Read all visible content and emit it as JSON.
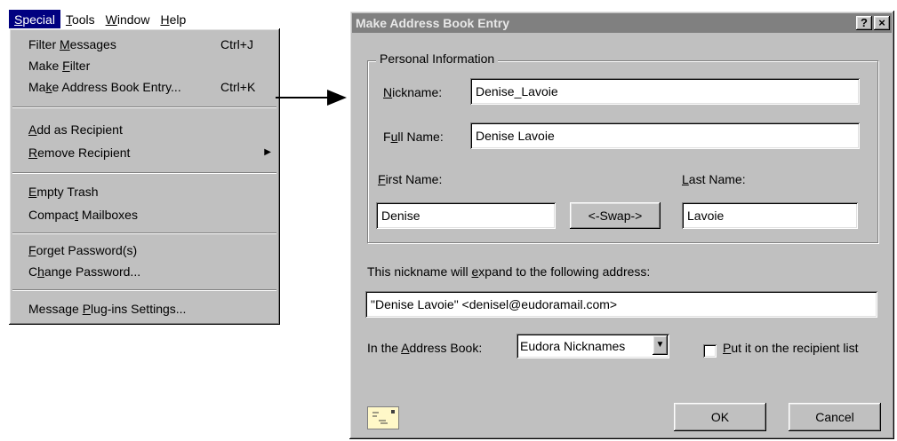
{
  "menubar": [
    {
      "label": "Special",
      "accel": "S"
    },
    {
      "label": "Tools",
      "accel": "T"
    },
    {
      "label": "Window",
      "accel": "W"
    },
    {
      "label": "Help",
      "accel": "H"
    }
  ],
  "menu": {
    "filter_messages": {
      "pre": "Filter ",
      "acc": "M",
      "post": "essages",
      "shortcut": "Ctrl+J"
    },
    "make_filter": {
      "pre": "Make ",
      "acc": "F",
      "post": "ilter"
    },
    "make_address_book_entry": {
      "pre": "Ma",
      "acc": "k",
      "post": "e Address Book Entry...",
      "shortcut": "Ctrl+K"
    },
    "add_as_recipient": {
      "pre": "",
      "acc": "A",
      "post": "dd as Recipient"
    },
    "remove_recipient": {
      "pre": "",
      "acc": "R",
      "post": "emove Recipient"
    },
    "empty_trash": {
      "pre": "",
      "acc": "E",
      "post": "mpty Trash"
    },
    "compact_mailboxes": {
      "pre": "Compac",
      "acc": "t",
      "post": " Mailboxes"
    },
    "forget_password": {
      "pre": "",
      "acc": "F",
      "post": "orget Password(s)"
    },
    "change_password": {
      "pre": "C",
      "acc": "h",
      "post": "ange Password..."
    },
    "plugin_settings": {
      "pre": "Message ",
      "acc": "P",
      "post": "lug-ins Settings..."
    }
  },
  "dialog": {
    "title": "Make Address Book Entry",
    "help_label": "?",
    "close_label": "×",
    "group_label": "Personal Information",
    "nickname": {
      "pre": "",
      "acc": "N",
      "post": "ickname:",
      "value": "Denise_Lavoie"
    },
    "full_name": {
      "pre": "F",
      "acc": "u",
      "post": "ll Name:",
      "value": "Denise Lavoie"
    },
    "first_name": {
      "pre": "",
      "acc": "F",
      "post": "irst Name:",
      "value": "Denise"
    },
    "last_name": {
      "pre": "",
      "acc": "L",
      "post": "ast Name:",
      "value": "Lavoie"
    },
    "swap_label": "<-Swap->",
    "expand": {
      "pre": "This nickname will ",
      "acc": "e",
      "post": "xpand to the following address:",
      "value": "\"Denise Lavoie\" <denisel@eudoramail.com>"
    },
    "address_book": {
      "pre": "In the ",
      "acc": "A",
      "post": "ddress Book:",
      "value": "Eudora Nicknames"
    },
    "recipient_list": {
      "pre": "",
      "acc": "P",
      "post": "ut it on the recipient list"
    },
    "ok_label": "OK",
    "cancel_label": "Cancel"
  }
}
